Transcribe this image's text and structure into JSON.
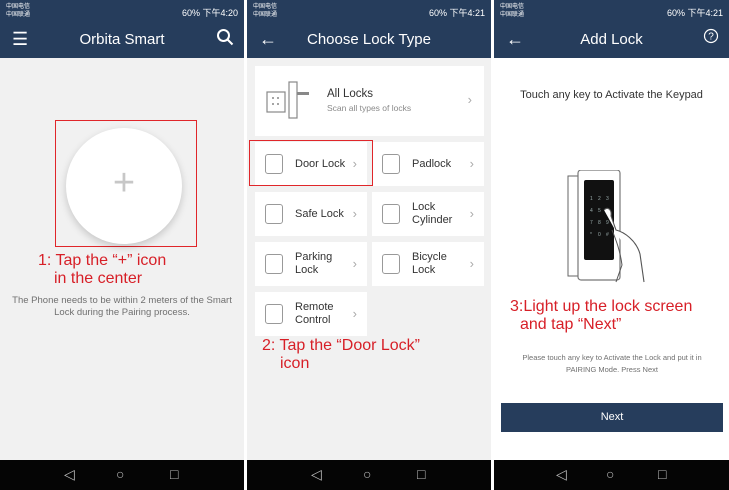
{
  "status": {
    "carrier_line1": "中国电信",
    "carrier_line2": "中国联通",
    "signal": "⁴⁶.ıll ⁴⁶.ıll",
    "battery_text": "60%",
    "time1": "下午4:20",
    "time2": "下午4:21",
    "time3": "下午4:21"
  },
  "screen1": {
    "title": "Orbita Smart",
    "menu_icon": "hamburger-icon",
    "search_icon": "search-icon",
    "plus": "+",
    "annotation_line1": "1: Tap the “+” icon",
    "annotation_line2": "in the center",
    "note": "The Phone needs to be within 2 meters of the Smart Lock during the Pairing process."
  },
  "screen2": {
    "title": "Choose Lock Type",
    "all_locks_title": "All Locks",
    "all_locks_sub": "Scan all types of locks",
    "items": [
      {
        "label": "Door Lock",
        "icon": "door-lock-icon"
      },
      {
        "label": "Padlock",
        "icon": "padlock-icon"
      },
      {
        "label": "Safe Lock",
        "icon": "safe-lock-icon"
      },
      {
        "label": "Lock\nCylinder",
        "icon": "lock-cylinder-icon"
      },
      {
        "label": "Parking\nLock",
        "icon": "parking-lock-icon"
      },
      {
        "label": "Bicycle\nLock",
        "icon": "bicycle-lock-icon"
      },
      {
        "label": "Remote\nControl",
        "icon": "remote-control-icon"
      }
    ],
    "annotation_line1": "2: Tap the “Door Lock”",
    "annotation_line2": "icon"
  },
  "screen3": {
    "title": "Add Lock",
    "help_icon": "help-icon",
    "instruction": "Touch any key to Activate the Keypad",
    "annotation_line1": "3:Light up the lock screen",
    "annotation_line2": "and tap “Next”",
    "note": "Please touch any key to Activate the Lock and put it in PAIRING Mode. Press Next",
    "next_label": "Next"
  },
  "colors": {
    "primary": "#263d5c",
    "annotation_red": "#d71f27",
    "background": "#f1f1f1"
  }
}
